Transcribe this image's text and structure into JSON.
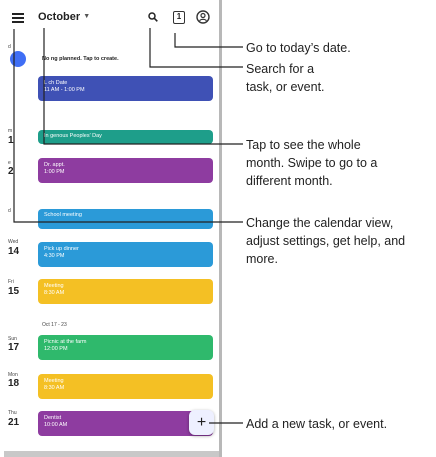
{
  "app": {
    "month": "October",
    "today_badge": "1",
    "nothing_planned": "No   ng planned. Tap to create."
  },
  "days": [
    {
      "label": "d",
      "num": ""
    },
    {
      "label": "m",
      "num": "1"
    },
    {
      "label": "e",
      "num": "2"
    },
    {
      "label": "d",
      "num": ""
    },
    {
      "label": "Wed",
      "num": "14"
    },
    {
      "label": "Fri",
      "num": "15"
    },
    {
      "label": "Sun",
      "num": "17"
    },
    {
      "label": "Mon",
      "num": "18"
    },
    {
      "label": "Thu",
      "num": "21"
    }
  ],
  "week_label": "Oct 17 - 23",
  "events": [
    {
      "title": "L  ch Date",
      "sub": "11   AM - 1:00 PM",
      "color": "#3f51b5"
    },
    {
      "title": "In   genous Peoples' Day",
      "sub": "",
      "color": "#1e9e8a"
    },
    {
      "title": "Dr. appt.",
      "sub": "1:00 PM",
      "color": "#8e3ca0"
    },
    {
      "title": "School meeting",
      "sub": "",
      "color": "#2b9ad8"
    },
    {
      "title": "Pick up dinner",
      "sub": "4:30 PM",
      "color": "#2b9ad8"
    },
    {
      "title": "Meeting",
      "sub": "8:30 AM",
      "color": "#f4c024"
    },
    {
      "title": "Picnic at the farm",
      "sub": "12:00 PM",
      "color": "#2fb96c"
    },
    {
      "title": "Meeting",
      "sub": "8:30 AM",
      "color": "#f4c024"
    },
    {
      "title": "Dentist",
      "sub": "10:00 AM",
      "color": "#8e3ca0"
    }
  ],
  "fab_label": "+",
  "callouts": {
    "today": "Go to today’s date.",
    "search_1": "Search for a",
    "search_2": "task, or event.",
    "month_1": "Tap to see the whole",
    "month_2": "month. Swipe to go to a",
    "month_3": "different month.",
    "menu_1": "Change the calendar view,",
    "menu_2": "adjust settings, get help, and",
    "menu_3": "more.",
    "add": "Add a new task, or event."
  },
  "icons": [
    "menu-icon",
    "search-icon",
    "today-icon",
    "account-icon",
    "add-icon"
  ]
}
